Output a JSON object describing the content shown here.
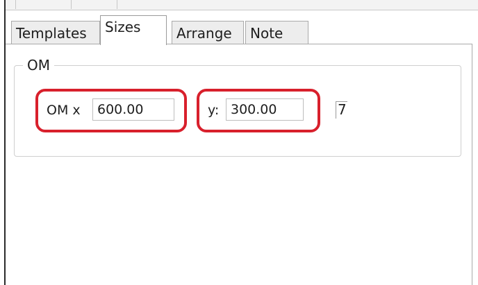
{
  "tabs": [
    {
      "label": "Templates",
      "active": false
    },
    {
      "label": "Sizes",
      "active": true
    },
    {
      "label": "Arrange",
      "active": false
    },
    {
      "label": "Note",
      "active": false
    }
  ],
  "group": {
    "title": "OM",
    "om_x_label": "OM x",
    "om_x_value": "600.00",
    "y_label": "y:",
    "y_value": "300.00",
    "aux_value": "7"
  },
  "colors": {
    "highlight": "#d8202c",
    "tab_bg": "#ededed",
    "border": "#a9a9a9"
  }
}
